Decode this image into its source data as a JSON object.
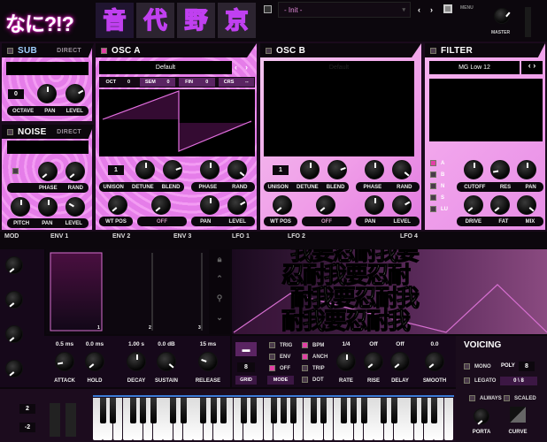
{
  "header": {
    "logo": "なに?!?",
    "tabs": [
      "音",
      "代",
      "野",
      "京"
    ],
    "preset": "- Init -",
    "menu": "MENU",
    "master": "MASTER"
  },
  "sub": {
    "title": "SUB",
    "direct": "DIRECT",
    "octave_value": "0",
    "labels": [
      "OCTAVE",
      "PAN",
      "LEVEL"
    ]
  },
  "noise": {
    "title": "NOISE",
    "direct": "DIRECT",
    "row1": [
      "PHASE",
      "RAND"
    ],
    "row2": [
      "PITCH",
      "PAN",
      "LEVEL"
    ]
  },
  "osc_a": {
    "title": "OSC A",
    "wavetable": "Default",
    "params": [
      {
        "k": "OCT",
        "v": "0"
      },
      {
        "k": "SEM",
        "v": "0"
      },
      {
        "k": "FIN",
        "v": "0"
      },
      {
        "k": "CRS",
        "v": "--"
      }
    ],
    "unison": "1",
    "row1a": [
      "UNISON",
      "DETUNE",
      "BLEND"
    ],
    "row1b": [
      "PHASE",
      "RAND"
    ],
    "row2a": "WT POS",
    "warp": "OFF",
    "row2b": [
      "PAN",
      "LEVEL"
    ]
  },
  "osc_b": {
    "title": "OSC B",
    "wavetable": "Default",
    "unison": "1",
    "row1a": [
      "UNISON",
      "DETUNE",
      "BLEND"
    ],
    "row1b": [
      "PHASE",
      "RAND"
    ],
    "row2a": "WT POS",
    "warp": "OFF",
    "row2b": [
      "PAN",
      "LEVEL"
    ]
  },
  "filter": {
    "title": "FILTER",
    "type": "MG Low 12",
    "routes": [
      "A",
      "B",
      "N",
      "S",
      "LU"
    ],
    "row1": [
      "CUTOFF",
      "RES",
      "PAN"
    ],
    "row2": [
      "DRIVE",
      "FAT",
      "MIX"
    ]
  },
  "mod_tabs": [
    "MOD",
    "ENV 1",
    "ENV 2",
    "ENV 3",
    "LFO 1",
    "LFO 2",
    "LFO 4"
  ],
  "env": {
    "values": [
      "0.5 ms",
      "0.0 ms",
      "1.00 s",
      "0.0 dB",
      "15 ms"
    ],
    "labels": [
      "ATTACK",
      "HOLD",
      "DECAY",
      "SUSTAIN",
      "RELEASE"
    ],
    "markers": [
      "1",
      "2",
      "3"
    ]
  },
  "lfo": {
    "grid": "8",
    "grid_label": "GRID",
    "mode_label": "MODE",
    "modes": [
      "TRIG",
      "ENV",
      "OFF"
    ],
    "opts": [
      "BPM",
      "ANCH",
      "TRIP",
      "DOT"
    ],
    "values": [
      "1/4",
      "Off",
      "Off",
      "0.0"
    ],
    "labels": [
      "RATE",
      "RISE",
      "DELAY",
      "SMOOTH"
    ],
    "overlay_text": [
      "我要忍耐我要",
      "忍耐我要忍耐",
      "耐我要忍耐我",
      "耐我要忍耐我"
    ]
  },
  "voicing": {
    "title": "VOICING",
    "mono": "MONO",
    "legato": "LEGATO",
    "poly_label": "POLY",
    "poly": "8",
    "voices": "0 \\ 8",
    "always": "ALWAYS",
    "scaled": "SCALED",
    "porta": "PORTA",
    "curve": "CURVE"
  },
  "keyboard": {
    "pitch_up": "2",
    "pitch_down": "-2",
    "white_keys": 36
  },
  "colors": {
    "pink": "#e57de9",
    "accent": "#e33fa6",
    "dark": "#16081a"
  }
}
